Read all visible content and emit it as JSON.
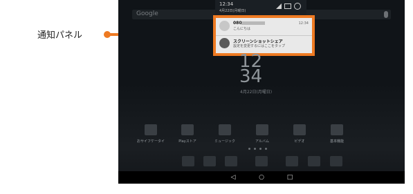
{
  "callout": {
    "label": "通知パネル"
  },
  "status_bar": {
    "time": "12:34",
    "date": "4月22日(月曜日)"
  },
  "search": {
    "placeholder": "Google"
  },
  "notifications": [
    {
      "title": "080",
      "subtitle": "こんにちは",
      "time": "12:34",
      "icon": "person-icon"
    },
    {
      "title": "スクリーンショットシェア",
      "subtitle": "設定を変更するにはここをタップ",
      "icon": "screenshot-share-icon"
    }
  ],
  "lockscreen_clock": {
    "hour": "12",
    "minute": "34",
    "date": "4月22日(月曜日)"
  },
  "apps": [
    {
      "label": "おサイフケータイ",
      "icon": "wallet-icon"
    },
    {
      "label": "Playストア",
      "icon": "store-icon"
    },
    {
      "label": "ミュージック",
      "icon": "music-icon"
    },
    {
      "label": "アルバム",
      "icon": "album-icon"
    },
    {
      "label": "ビデオ",
      "icon": "video-icon"
    },
    {
      "label": "基本機能",
      "icon": "tools-icon"
    }
  ],
  "dock": [
    {
      "icon": "browser-icon"
    },
    {
      "icon": "mail-icon"
    },
    {
      "icon": "contacts-icon"
    },
    {
      "icon": "app-drawer-icon"
    },
    {
      "icon": "bookmark-icon"
    },
    {
      "icon": "tv-icon"
    },
    {
      "icon": "camera-icon"
    }
  ],
  "navigation": {
    "back": "◁",
    "home": "○",
    "recent": "□"
  },
  "colors": {
    "accent": "#ee7a22",
    "panel_background": "#e9e9e9",
    "screen_background": "#101418"
  }
}
